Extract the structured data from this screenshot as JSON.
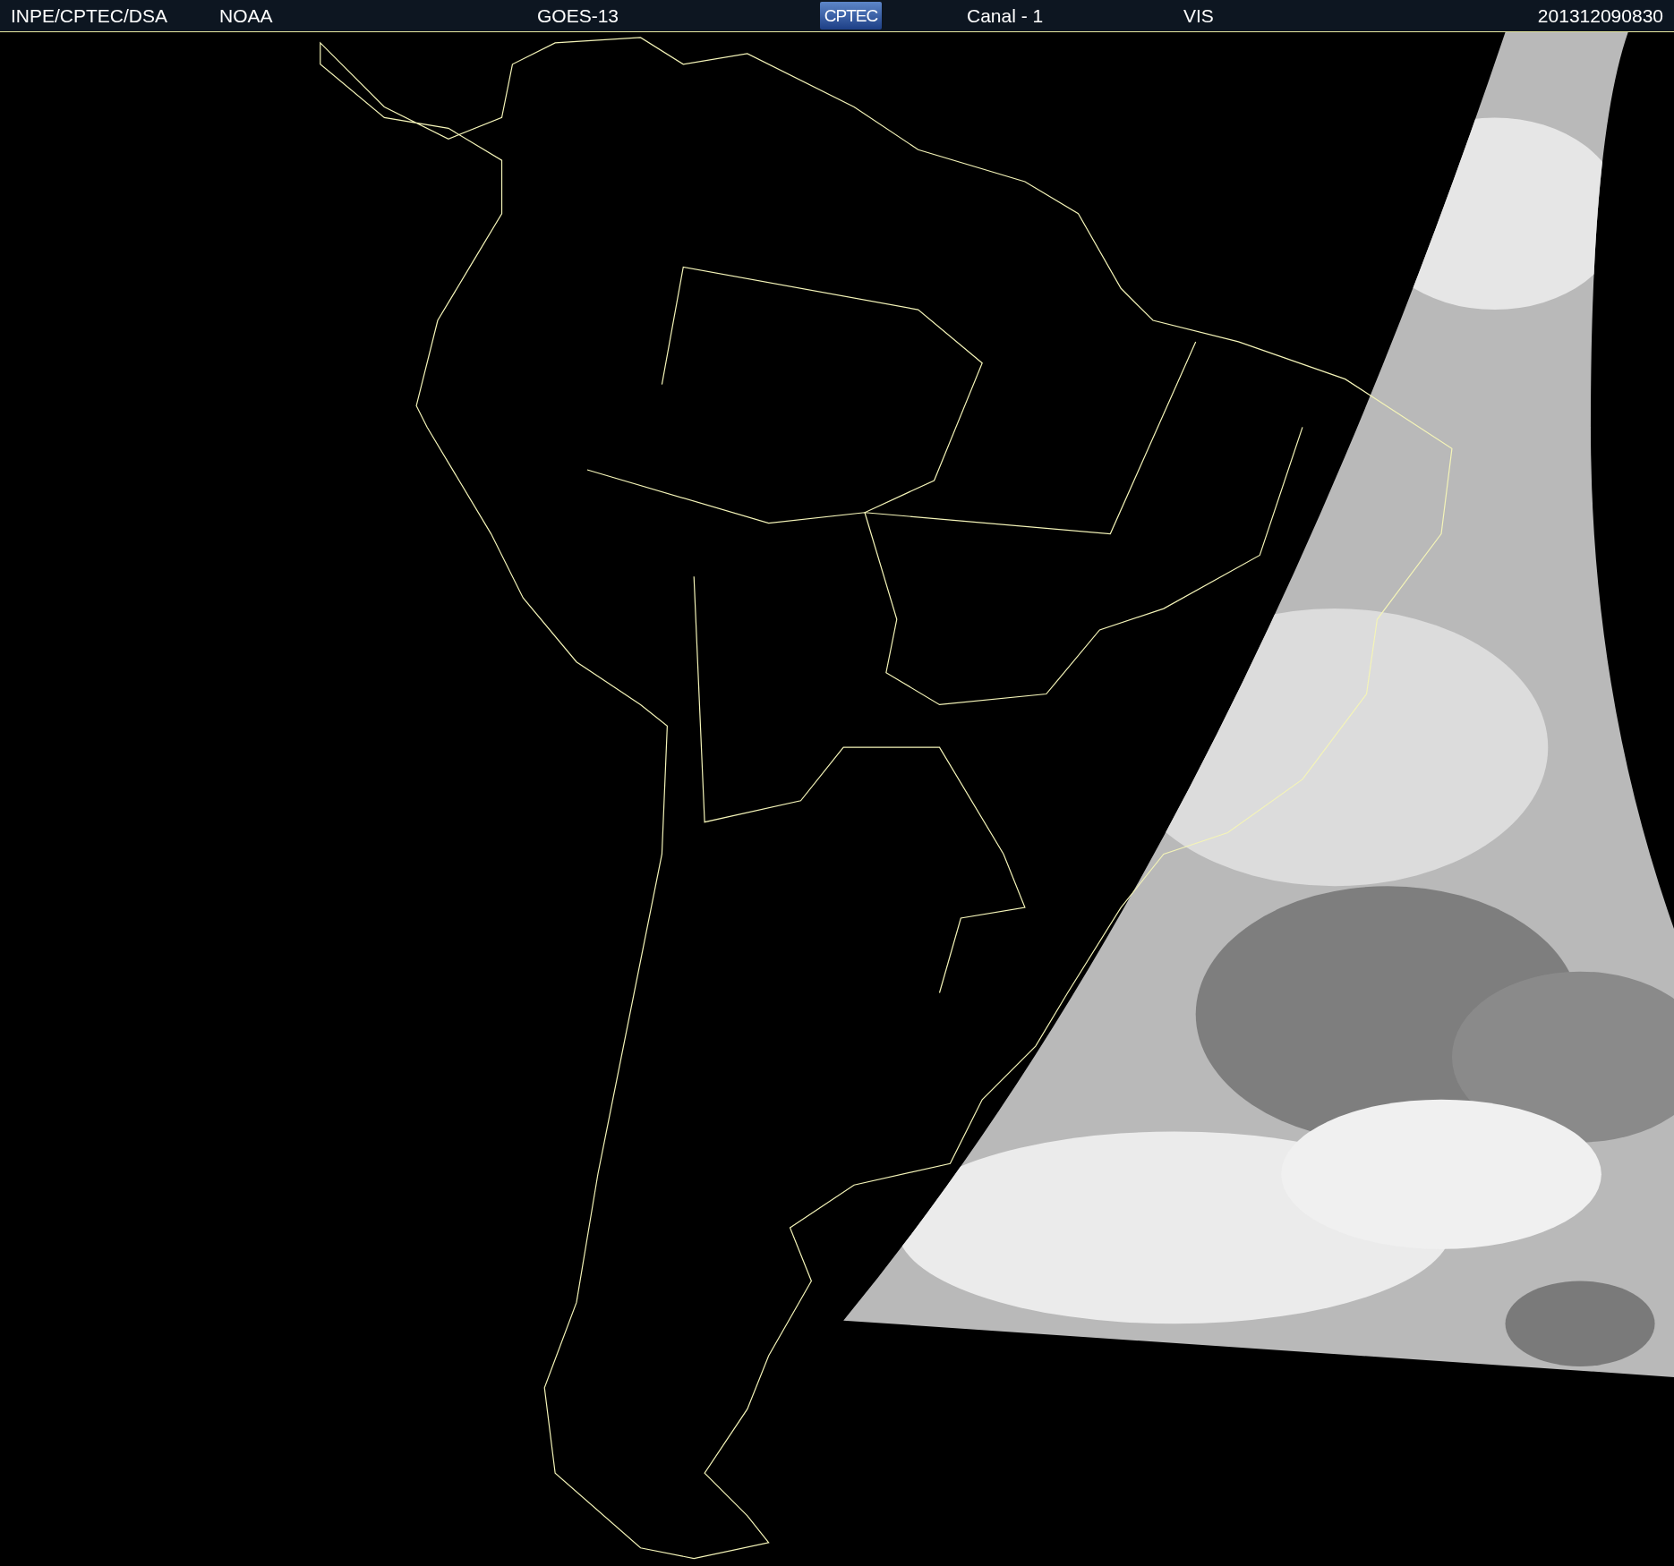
{
  "header": {
    "items": [
      {
        "kind": "text",
        "label": "INPE/CPTEC/DSA"
      },
      {
        "kind": "text",
        "label": "NOAA"
      },
      {
        "kind": "text",
        "label": "GOES-13"
      },
      {
        "kind": "logo",
        "label": "CPTEC"
      },
      {
        "kind": "text",
        "label": "Canal - 1"
      },
      {
        "kind": "text",
        "label": "VIS"
      },
      {
        "kind": "text",
        "label": "201312090830"
      }
    ]
  }
}
